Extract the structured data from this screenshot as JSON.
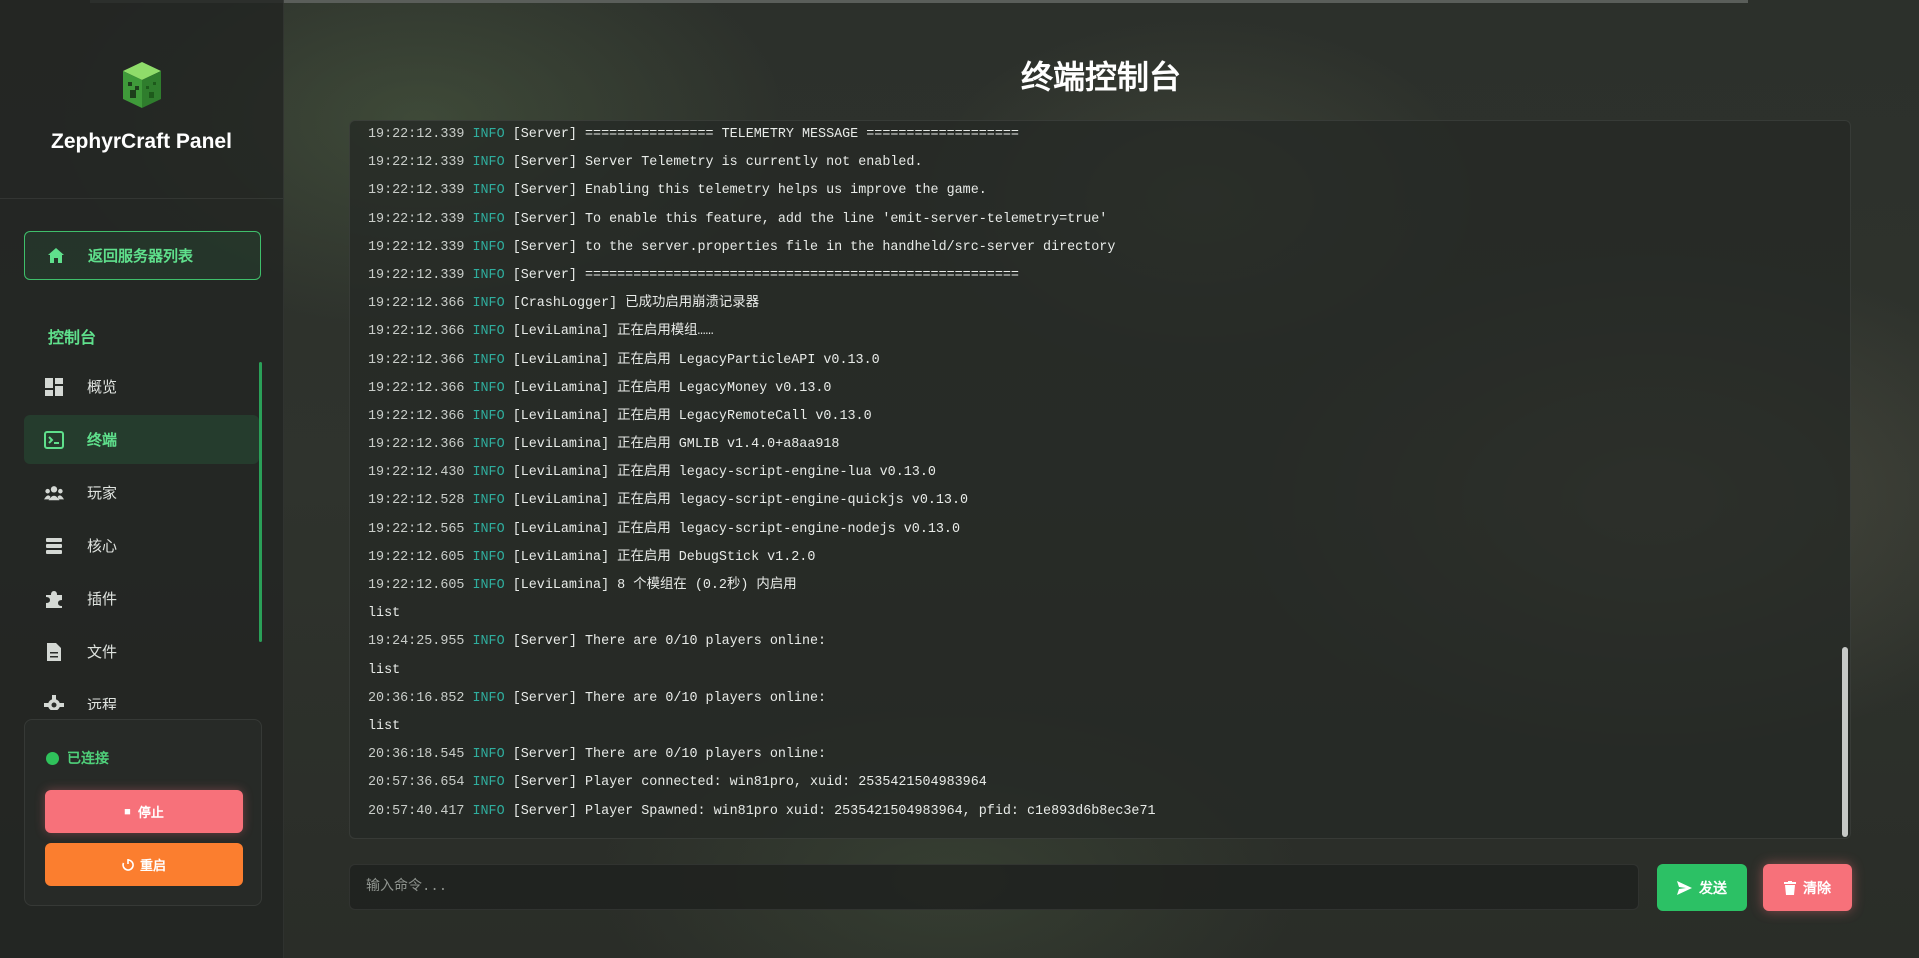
{
  "brand": {
    "name": "ZephyrCraft Panel",
    "logo_icon": "creeper-block-icon"
  },
  "sidebar": {
    "back_label": "返回服务器列表",
    "section_title": "控制台",
    "items": [
      {
        "label": "概览",
        "icon": "dashboard-icon"
      },
      {
        "label": "终端",
        "icon": "terminal-icon",
        "active": true
      },
      {
        "label": "玩家",
        "icon": "players-icon"
      },
      {
        "label": "核心",
        "icon": "server-core-icon"
      },
      {
        "label": "插件",
        "icon": "puzzle-icon"
      },
      {
        "label": "文件",
        "icon": "file-icon"
      },
      {
        "label": "远程",
        "icon": "gear-icon"
      }
    ],
    "status": {
      "label": "已连接",
      "color": "#2fc25b"
    },
    "stop_label": "停止",
    "restart_label": "重启"
  },
  "page": {
    "title": "终端控制台"
  },
  "console": {
    "lines": [
      {
        "ts": "19:22:12.339",
        "level": "INFO",
        "msg": "[Server] ================ TELEMETRY MESSAGE ==================="
      },
      {
        "ts": "19:22:12.339",
        "level": "INFO",
        "msg": "[Server] Server Telemetry is currently not enabled."
      },
      {
        "ts": "19:22:12.339",
        "level": "INFO",
        "msg": "[Server] Enabling this telemetry helps us improve the game."
      },
      {
        "ts": "19:22:12.339",
        "level": "INFO",
        "msg": "[Server] To enable this feature, add the line 'emit-server-telemetry=true'"
      },
      {
        "ts": "19:22:12.339",
        "level": "INFO",
        "msg": "[Server] to the server.properties file in the handheld/src-server directory"
      },
      {
        "ts": "19:22:12.339",
        "level": "INFO",
        "msg": "[Server] ======================================================"
      },
      {
        "ts": "19:22:12.366",
        "level": "INFO",
        "msg": "[CrashLogger] 已成功启用崩溃记录器"
      },
      {
        "ts": "19:22:12.366",
        "level": "INFO",
        "msg": "[LeviLamina] 正在启用模组……"
      },
      {
        "ts": "19:22:12.366",
        "level": "INFO",
        "msg": "[LeviLamina] 正在启用 LegacyParticleAPI v0.13.0"
      },
      {
        "ts": "19:22:12.366",
        "level": "INFO",
        "msg": "[LeviLamina] 正在启用 LegacyMoney v0.13.0"
      },
      {
        "ts": "19:22:12.366",
        "level": "INFO",
        "msg": "[LeviLamina] 正在启用 LegacyRemoteCall v0.13.0"
      },
      {
        "ts": "19:22:12.366",
        "level": "INFO",
        "msg": "[LeviLamina] 正在启用 GMLIB v1.4.0+a8aa918"
      },
      {
        "ts": "19:22:12.430",
        "level": "INFO",
        "msg": "[LeviLamina] 正在启用 legacy-script-engine-lua v0.13.0"
      },
      {
        "ts": "19:22:12.528",
        "level": "INFO",
        "msg": "[LeviLamina] 正在启用 legacy-script-engine-quickjs v0.13.0"
      },
      {
        "ts": "19:22:12.565",
        "level": "INFO",
        "msg": "[LeviLamina] 正在启用 legacy-script-engine-nodejs v0.13.0"
      },
      {
        "ts": "19:22:12.605",
        "level": "INFO",
        "msg": "[LeviLamina] 正在启用 DebugStick v1.2.0"
      },
      {
        "ts": "19:22:12.605",
        "level": "INFO",
        "msg": "[LeviLamina] 8 个模组在 (0.2秒) 内启用"
      },
      {
        "ts": "",
        "level": "",
        "msg": "list"
      },
      {
        "ts": "19:24:25.955",
        "level": "INFO",
        "msg": "[Server] There are 0/10 players online:"
      },
      {
        "ts": "",
        "level": "",
        "msg": "list"
      },
      {
        "ts": "20:36:16.852",
        "level": "INFO",
        "msg": "[Server] There are 0/10 players online:"
      },
      {
        "ts": "",
        "level": "",
        "msg": "list"
      },
      {
        "ts": "20:36:18.545",
        "level": "INFO",
        "msg": "[Server] There are 0/10 players online:"
      },
      {
        "ts": "20:57:36.654",
        "level": "INFO",
        "msg": "[Server] Player connected: win81pro, xuid: 2535421504983964"
      },
      {
        "ts": "20:57:40.417",
        "level": "INFO",
        "msg": "[Server] Player Spawned: win81pro xuid: 2535421504983964, pfid: c1e893d6b8ec3e71"
      }
    ],
    "scroll_fraction": 0.74
  },
  "command": {
    "placeholder": "输入命令...",
    "value": ""
  },
  "actions": {
    "send_label": "发送",
    "clear_label": "清除"
  },
  "colors": {
    "accent": "#2cc165",
    "danger": "#f7717a",
    "warning": "#fb7e2f",
    "log_level": "#2fae9e"
  }
}
